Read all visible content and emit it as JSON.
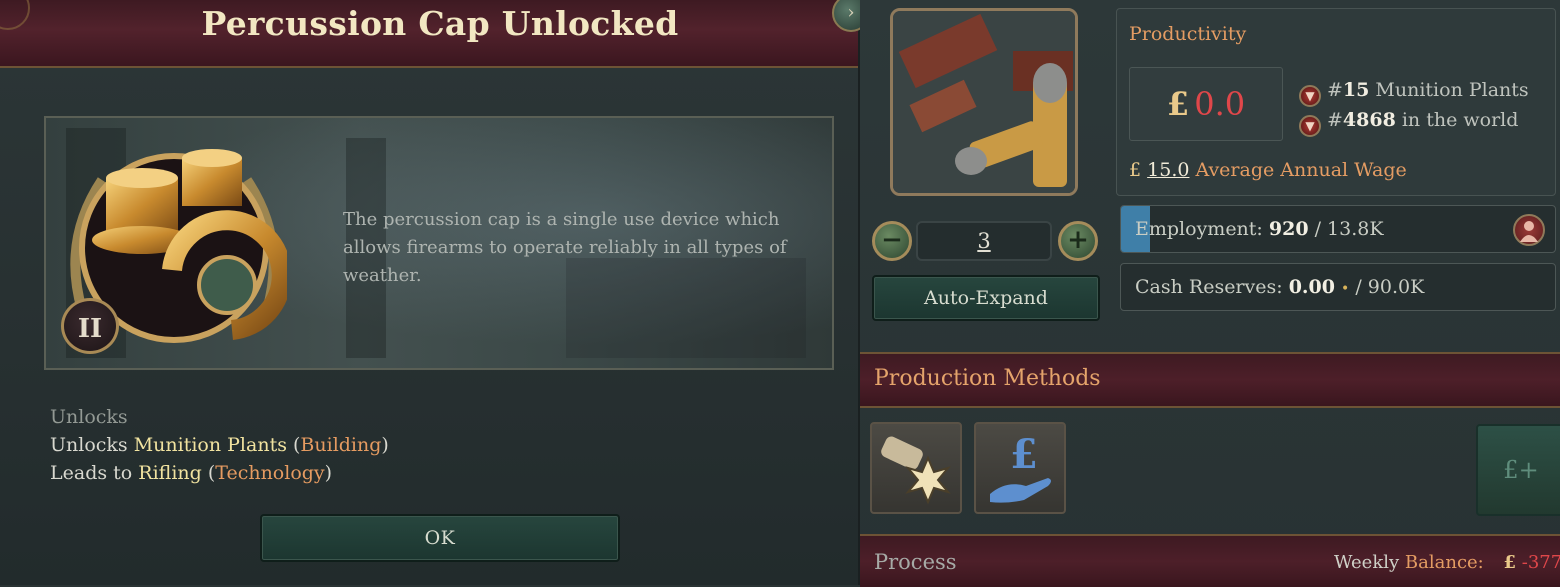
{
  "popup": {
    "title": "Percussion Cap Unlocked",
    "tier": "II",
    "description": "The percussion cap is a single use device which allows firearms to operate reliably in all types of weather.",
    "unlocks_heading": "Unlocks",
    "unlock_lines": [
      {
        "prefix": "Unlocks ",
        "name": "Munition Plants",
        "open": " (",
        "type": "Building",
        "close": ")"
      },
      {
        "prefix": "Leads to ",
        "name": "Rifling",
        "open": " (",
        "type": "Technology",
        "close": ")"
      }
    ],
    "ok_label": "OK",
    "close_icon": "chevron-right-icon"
  },
  "building": {
    "image_icon": "munitions-bullets-icon",
    "level": "3",
    "auto_expand_label": "Auto-Expand",
    "productivity": {
      "label": "Productivity",
      "currency": "£",
      "value": "0.0",
      "rank_building_hash": "#",
      "rank_building_num": "15",
      "rank_building_text": " Munition Plants",
      "rank_world_hash": "#",
      "rank_world_num": "4868",
      "rank_world_text": " in the world",
      "wage_currency": "£",
      "wage_value": "15.0",
      "wage_label": " Average Annual Wage"
    },
    "employment": {
      "label": "Employment: ",
      "current": "920",
      "separator": "  / ",
      "max": "13.8K",
      "fill_fraction": 0.067
    },
    "cash": {
      "label": "Cash Reserves: ",
      "current": "0.00",
      "dot": "•",
      "separator": " / ",
      "max": "90.0K"
    },
    "production_methods": {
      "title": "Production Methods",
      "slots": [
        "explosive-shell-icon",
        "pound-hand-icon"
      ],
      "add_label": "£+"
    },
    "process": {
      "label": "Process",
      "weekly_word": "Weekly ",
      "balance_word": "Balance:",
      "currency": "£",
      "value": "-377"
    }
  },
  "colors": {
    "header_crimson": "#4d1f29",
    "accent_orange": "#e49c63",
    "negative_red": "#e0474a",
    "button_green": "#27463e",
    "employment_fill": "#3f7fa8"
  }
}
